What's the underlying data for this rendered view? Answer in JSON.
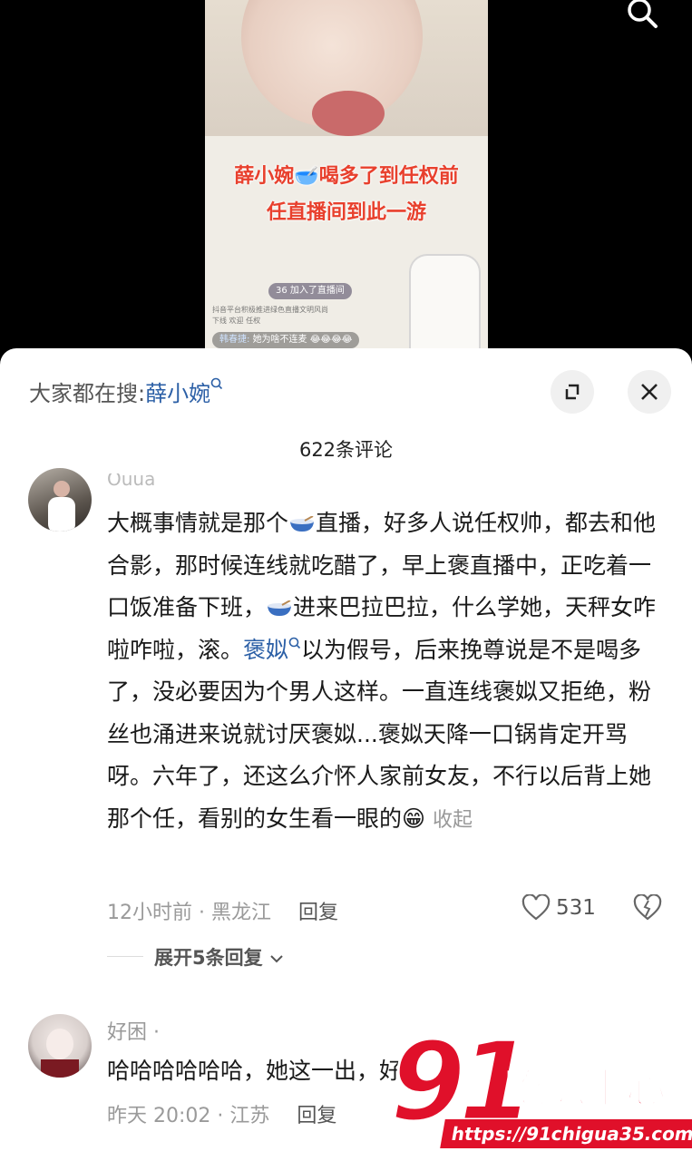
{
  "video": {
    "caption_line1": "薛小婉🥣喝多了到任权前",
    "caption_line2": "任直播间到此一游",
    "join_text": "加入了直播间",
    "join_level": "36",
    "tiny_notice_1": "抖音平台积极推进绿色直播文明风尚",
    "tiny_notice_2": "下线    欢迎 任权",
    "live_comment_user": "韩春捷:",
    "live_comment_text": "她为啥不连麦 😂😂😂😂"
  },
  "search_bar": {
    "prefix": "大家都在搜:",
    "keyword": "薛小婉",
    "search_mark": "Q"
  },
  "comments_count": "622条评论",
  "comment1": {
    "username": "Ouua",
    "text_a": "大概事情就是那个",
    "text_b": "直播，好多人说任权帅，都去和他合影，那时候连线就吃醋了，早上褒直播中，正吃着一口饭准备下班，",
    "text_c": "进来巴拉巴拉，什么学她，天秤女咋啦咋啦，滚。",
    "link": "褒姒",
    "text_d": "以为假号，后来挽尊说是不是喝多了，没必要因为个男人这样。一直连线褒姒又拒绝，粉丝也涌进来说就讨厌褒姒...褒姒天降一口锅肯定开骂呀。六年了，还这么介怀人家前女友，不行以后背上她那个任，看别的女生看一眼的",
    "emoji": "😁",
    "collapse": "收起",
    "time_location": "12小时前 · 黑龙江",
    "reply": "回复",
    "likes": "531",
    "expand": "展开5条回复"
  },
  "comment2": {
    "username": "好困 ·",
    "text": "哈哈哈哈哈哈，她这一出，好",
    "time_location": "昨天 20:02 · 江苏",
    "reply": "回复"
  },
  "watermark": {
    "big_number": "91",
    "brand": "吃瓜中心",
    "url": "https://91chigua35.com"
  },
  "colors": {
    "link": "#2b5fa6",
    "watermark_red": "#e0102a"
  }
}
